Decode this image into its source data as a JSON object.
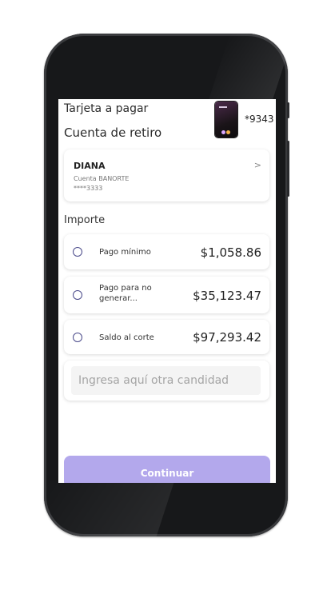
{
  "header": {
    "title": "Tarjeta a pagar",
    "card_number": "*9343",
    "subtitle": "Cuenta de retiro"
  },
  "account": {
    "name": "DIANA",
    "bank": "Cuenta BANORTE",
    "number": "****3333",
    "chevron": ">"
  },
  "importe": {
    "label": "Importe",
    "options": [
      {
        "label": "Pago mínimo",
        "amount": "$1,058.86"
      },
      {
        "label_line1": "Pago para no",
        "label_line2": "generar...",
        "amount": "$35,123.47"
      },
      {
        "label": "Saldo al corte",
        "amount": "$97,293.42"
      }
    ],
    "other_placeholder": "Ingresa aquí otra candidad"
  },
  "footer": {
    "continue_label": "Continuar"
  },
  "colors": {
    "accent": "#b3a8ec",
    "frame": "#17181a",
    "radio": "#4a4a8a"
  }
}
